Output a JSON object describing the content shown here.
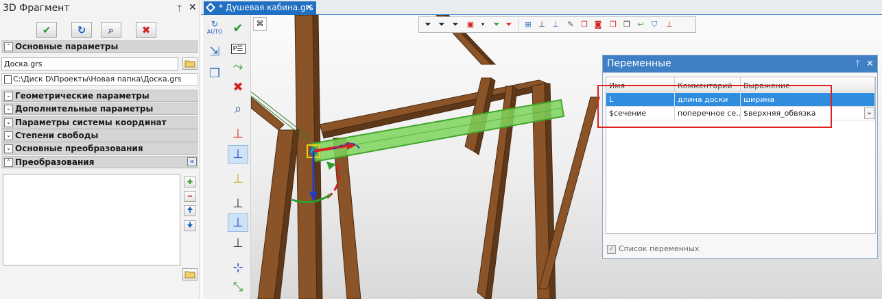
{
  "panel": {
    "title": "3D Фрагмент",
    "pin_glyph": "ᛘ",
    "close_glyph": "✕",
    "buttons": [
      {
        "name": "ok",
        "glyph": "✔",
        "color": "#2e9b2e"
      },
      {
        "name": "refresh",
        "glyph": "↻",
        "color": "#1f5fbf"
      },
      {
        "name": "preview",
        "glyph": "⌕",
        "color": "#3a5f8a"
      },
      {
        "name": "cancel",
        "glyph": "✖",
        "color": "#d22424"
      }
    ],
    "sections": {
      "main_params": "Основные параметры",
      "geometry": "Геометрические параметры",
      "additional": "Дополнительные параметры",
      "coord_system": "Параметры системы координат",
      "dof": "Степени свободы",
      "main_transforms": "Основные преобразования",
      "transforms": "Преобразования"
    },
    "file_value": "Доска.grs",
    "path": "C:\\Диск D\\Проекты\\Новая папка\\Доска.grs",
    "expand_glyph": "»",
    "side_buttons": {
      "add": "✚",
      "remove": "━",
      "up": "🠉",
      "down": "🠋"
    }
  },
  "tab": {
    "title": "* Душевая кабина.grs",
    "close_glyph": "✕"
  },
  "vtoolbar": {
    "auto_label": "AUTO"
  },
  "variables": {
    "title": "Переменные",
    "pin_glyph": "ᛘ",
    "close_glyph": "✕",
    "columns": [
      "Имя",
      "Комментарий",
      "Выражение"
    ],
    "rows": [
      {
        "name": "L",
        "comment": "длина доски",
        "expr": "ширина"
      },
      {
        "name": "$сечение",
        "comment": "поперечное се...",
        "expr": "$верхняя_обвязка"
      }
    ],
    "checkbox_label": "Список переменных",
    "checkbox_glyph": "✓",
    "dropdown_glyph": "⌄"
  },
  "colors": {
    "accent": "#1f6fc2",
    "wood": "#8a5428",
    "selected_beam": "#7fd35a",
    "highlight": "#e02020"
  }
}
